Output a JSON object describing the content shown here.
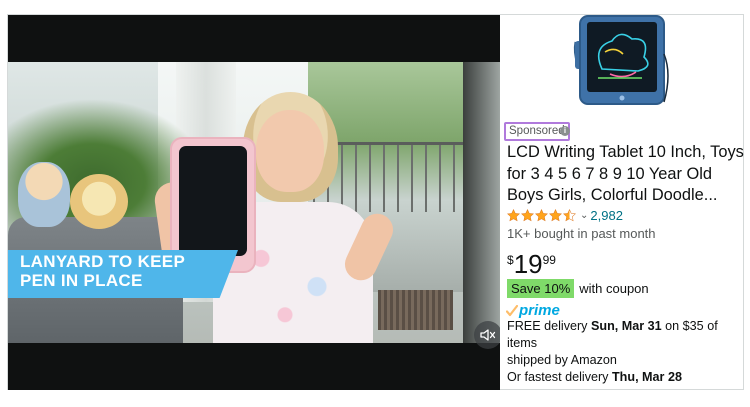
{
  "video": {
    "caption": "LANYARD TO KEEP\nPEN IN PLACE",
    "mute_icon": "speaker-muted-icon"
  },
  "product": {
    "thumbnail_icon": "lcd-writing-tablet-thumbnail",
    "sponsored_label": "Sponsored",
    "info_icon": "i",
    "title": "LCD Writing Tablet 10 Inch, Toys for 3 4 5 6 7 8 9 10 Year Old Boys Girls, Colorful Doodle...",
    "rating": 4.5,
    "rating_count": "2,982",
    "rating_dropdown_icon": "chevron-down-icon",
    "bought_text": "1K+ bought in past month",
    "price": {
      "symbol": "$",
      "whole": "19",
      "fraction": "99"
    },
    "coupon": {
      "badge": "Save 10%",
      "text": "with coupon"
    },
    "prime_label": "prime",
    "delivery": {
      "line1_prefix": "FREE delivery ",
      "line1_date": "Sun, Mar 31",
      "line1_suffix": " on $35 of items",
      "line2": "shipped by Amazon",
      "line3_prefix": "Or fastest delivery ",
      "line3_date": "Thu, Mar 28"
    }
  },
  "colors": {
    "caption_bg": "#4fb6ea",
    "sponsored_border": "#b07adc",
    "star": "#ffa41c",
    "link": "#007185",
    "coupon_badge": "#7fda69",
    "prime": "#00a8e1"
  }
}
